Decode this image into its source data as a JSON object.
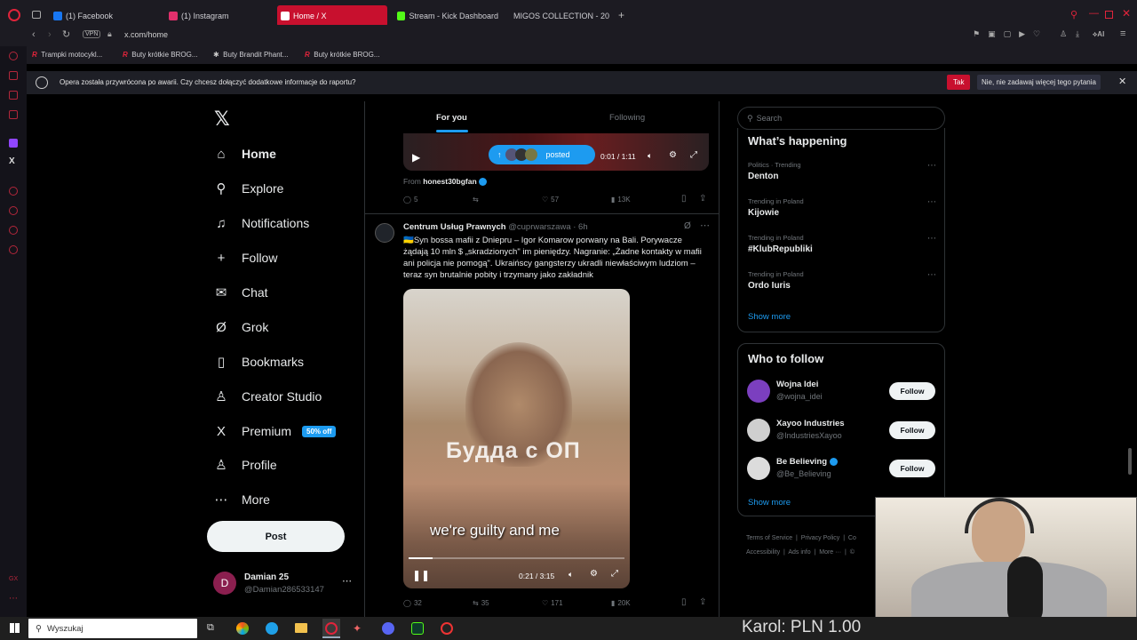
{
  "browser": {
    "tabs": [
      {
        "label": "(1) Facebook",
        "icon": "facebook-icon",
        "color": "#1877f2",
        "active": false
      },
      {
        "label": "(1) Instagram",
        "icon": "instagram-icon",
        "color": "#e1306c",
        "active": false
      },
      {
        "label": "Home / X",
        "icon": "x-icon",
        "color": "#ffffff",
        "active": true
      },
      {
        "label": "Stream - Kick Dashboard",
        "icon": "kick-icon",
        "color": "#53fc18",
        "active": false
      },
      {
        "label": "MIGOS COLLECTION - 20",
        "icon": "youtube-icon",
        "color": "#ff0000",
        "active": false
      }
    ],
    "address": "x.com/home",
    "vpn_label": "VPN",
    "ai_label": "AI",
    "bookmarks": [
      "Trampki motocykl...",
      "Buty krótkie BROG...",
      "Buty Brandit Phant...",
      "Buty krótkie BROG..."
    ],
    "infobar": {
      "message": "Opera została przywrócona po awarii. Czy chcesz dołączyć dodatkowe informacje do raportu?",
      "yes_label": "Tak",
      "no_label": "Nie, nie zadawaj więcej tego pytania"
    }
  },
  "nav": {
    "items": [
      {
        "label": "Home",
        "icon": "home-icon",
        "glyph": "⌂"
      },
      {
        "label": "Explore",
        "icon": "search-icon",
        "glyph": "⚲"
      },
      {
        "label": "Notifications",
        "icon": "bell-icon",
        "glyph": "♫"
      },
      {
        "label": "Follow",
        "icon": "follow-icon",
        "glyph": "+"
      },
      {
        "label": "Chat",
        "icon": "mail-icon",
        "glyph": "✉"
      },
      {
        "label": "Grok",
        "icon": "grok-icon",
        "glyph": "Ø"
      },
      {
        "label": "Bookmarks",
        "icon": "bookmark-icon",
        "glyph": "▯"
      },
      {
        "label": "Creator Studio",
        "icon": "creator-icon",
        "glyph": "♙"
      },
      {
        "label": "Premium",
        "icon": "x-premium-icon",
        "glyph": "X"
      },
      {
        "label": "Profile",
        "icon": "profile-icon",
        "glyph": "♙"
      },
      {
        "label": "More",
        "icon": "more-icon",
        "glyph": "⋯"
      }
    ],
    "premium_badge": "50% off",
    "post_label": "Post",
    "account": {
      "initial": "D",
      "name": "Damian 25",
      "handle": "@Damian286533147"
    }
  },
  "feed": {
    "tabs": [
      "For you",
      "Following"
    ],
    "top_video": {
      "posted_label": "posted",
      "time": "0:01 / 1:11",
      "from_prefix": "From",
      "from_user": "honest30bgfan",
      "actions": {
        "replies": "5",
        "reposts": "",
        "likes": "57",
        "views": "13K"
      }
    },
    "tweet": {
      "name": "Centrum Usług Prawnych",
      "handle": "@cuprwarszawa · 6h",
      "text": "🇺🇦Syn bossa mafii z Dniepru – Igor Komarow porwany na Bali. Porywacze żądają 10 mln $ „skradzionych\" im pieniędzy. Nagranie: „Żadne kontakty w mafii ani policja nie pomogą\". Ukraińscy gangsterzy ukradli niewłaściwym ludziom – teraz syn brutalnie pobity i trzymany jako zakładnik",
      "video_overlay": "Будда с ОП",
      "caption": "we're guilty and me",
      "time": "0:21 / 3:15",
      "progress": 0.11,
      "actions": {
        "replies": "32",
        "reposts": "35",
        "likes": "171",
        "views": "20K"
      }
    }
  },
  "sidebar": {
    "search_placeholder": "Search",
    "happening_title": "What’s happening",
    "trends": [
      {
        "category": "Politics · Trending",
        "name": "Denton"
      },
      {
        "category": "Trending in Poland",
        "name": "Kijowie"
      },
      {
        "category": "Trending in Poland",
        "name": "#KlubRepubliki"
      },
      {
        "category": "Trending in Poland",
        "name": "Ordo Iuris"
      }
    ],
    "show_more": "Show more",
    "wtf_title": "Who to follow",
    "follow_label": "Follow",
    "suggestions": [
      {
        "name": "Wojna Idei",
        "handle": "@wojna_idei",
        "verified": false,
        "color": "#7b3fbf"
      },
      {
        "name": "Xayoo Industries",
        "handle": "@IndustriesXayoo",
        "verified": false,
        "color": "#cfcfcf"
      },
      {
        "name": "Be Believing",
        "handle": "@Be_Believing",
        "verified": true,
        "color": "#dcdcdc"
      }
    ],
    "footer": [
      "Terms of Service",
      "Privacy Policy",
      "Co",
      "Accessibility",
      "Ads info",
      "More ···",
      "©"
    ]
  },
  "taskbar": {
    "search_placeholder": "Wyszukaj",
    "overlay_text": "Karol: PLN 1.00"
  }
}
